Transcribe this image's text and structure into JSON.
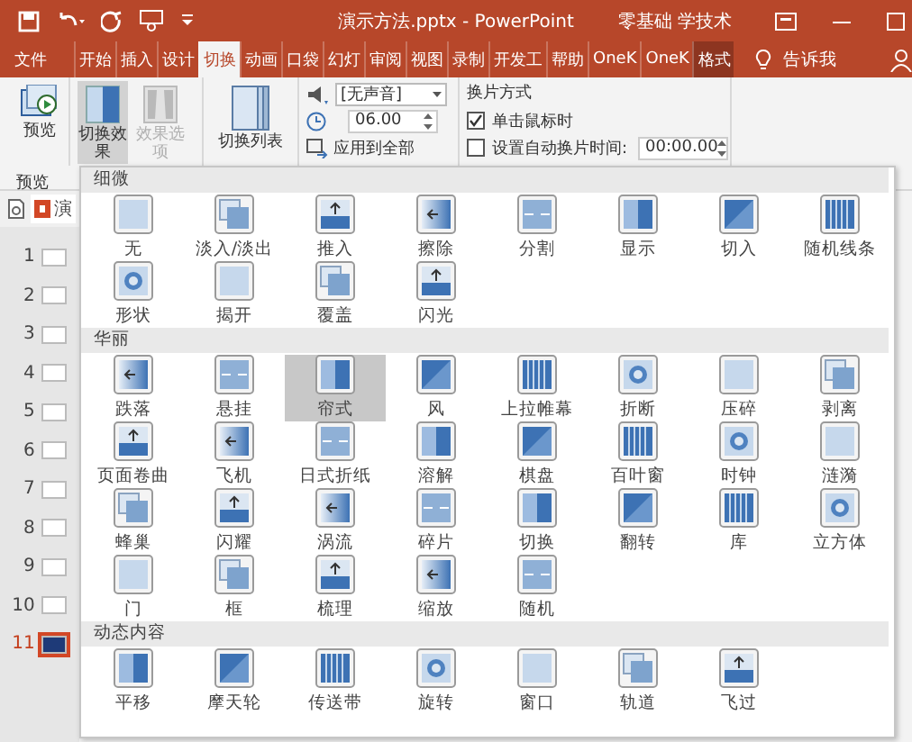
{
  "window": {
    "title": "演示方法.pptx  -  PowerPoint",
    "user": "零基础 学技术"
  },
  "tabs": [
    {
      "label": "文件",
      "selected": false,
      "contextual": false
    },
    {
      "label": "开始",
      "selected": false,
      "contextual": false
    },
    {
      "label": "插入",
      "selected": false,
      "contextual": false
    },
    {
      "label": "设计",
      "selected": false,
      "contextual": false
    },
    {
      "label": "切换",
      "selected": true,
      "contextual": false
    },
    {
      "label": "动画",
      "selected": false,
      "contextual": false
    },
    {
      "label": "口袋",
      "selected": false,
      "contextual": false
    },
    {
      "label": "幻灯",
      "selected": false,
      "contextual": false
    },
    {
      "label": "审阅",
      "selected": false,
      "contextual": false
    },
    {
      "label": "视图",
      "selected": false,
      "contextual": false
    },
    {
      "label": "录制",
      "selected": false,
      "contextual": false
    },
    {
      "label": "开发工",
      "selected": false,
      "contextual": false
    },
    {
      "label": "帮助",
      "selected": false,
      "contextual": false
    },
    {
      "label": "OneK",
      "selected": false,
      "contextual": false
    },
    {
      "label": "OneK",
      "selected": false,
      "contextual": false
    },
    {
      "label": "格式",
      "selected": false,
      "contextual": true
    }
  ],
  "tell_me": "告诉我",
  "ribbon": {
    "preview": "预览",
    "preview_group": "预览",
    "effects": "切换效果",
    "effect_options": {
      "label": "效果选项",
      "disabled": true
    },
    "list": "切换列表",
    "sound": "[无声音]",
    "duration": "06.00",
    "apply_all": "应用到全部",
    "advance_title": "换片方式",
    "on_click": {
      "label": "单击鼠标时",
      "checked": true
    },
    "after": {
      "label": "设置自动换片时间:",
      "checked": false,
      "value": "00:00.00"
    }
  },
  "slides": {
    "tab": "演",
    "items": [
      {
        "number": "1",
        "selected": false
      },
      {
        "number": "2",
        "selected": false
      },
      {
        "number": "3",
        "selected": false
      },
      {
        "number": "4",
        "selected": false
      },
      {
        "number": "5",
        "selected": false
      },
      {
        "number": "6",
        "selected": false
      },
      {
        "number": "7",
        "selected": false
      },
      {
        "number": "8",
        "selected": false
      },
      {
        "number": "9",
        "selected": false
      },
      {
        "number": "10",
        "selected": false
      },
      {
        "number": "11",
        "selected": true
      }
    ]
  },
  "gallery": {
    "sections": [
      {
        "title": "细微",
        "items": [
          {
            "label": "无",
            "selected": false
          },
          {
            "label": "淡入/淡出",
            "selected": false
          },
          {
            "label": "推入",
            "selected": false
          },
          {
            "label": "擦除",
            "selected": false
          },
          {
            "label": "分割",
            "selected": false
          },
          {
            "label": "显示",
            "selected": false
          },
          {
            "label": "切入",
            "selected": false
          },
          {
            "label": "随机线条",
            "selected": false
          },
          {
            "label": "形状",
            "selected": false
          },
          {
            "label": "揭开",
            "selected": false
          },
          {
            "label": "覆盖",
            "selected": false
          },
          {
            "label": "闪光",
            "selected": false
          }
        ]
      },
      {
        "title": "华丽",
        "items": [
          {
            "label": "跌落",
            "selected": false
          },
          {
            "label": "悬挂",
            "selected": false
          },
          {
            "label": "帘式",
            "selected": true
          },
          {
            "label": "风",
            "selected": false
          },
          {
            "label": "上拉帷幕",
            "selected": false
          },
          {
            "label": "折断",
            "selected": false
          },
          {
            "label": "压碎",
            "selected": false
          },
          {
            "label": "剥离",
            "selected": false
          },
          {
            "label": "页面卷曲",
            "selected": false
          },
          {
            "label": "飞机",
            "selected": false
          },
          {
            "label": "日式折纸",
            "selected": false
          },
          {
            "label": "溶解",
            "selected": false
          },
          {
            "label": "棋盘",
            "selected": false
          },
          {
            "label": "百叶窗",
            "selected": false
          },
          {
            "label": "时钟",
            "selected": false
          },
          {
            "label": "涟漪",
            "selected": false
          },
          {
            "label": "蜂巢",
            "selected": false
          },
          {
            "label": "闪耀",
            "selected": false
          },
          {
            "label": "涡流",
            "selected": false
          },
          {
            "label": "碎片",
            "selected": false
          },
          {
            "label": "切换",
            "selected": false
          },
          {
            "label": "翻转",
            "selected": false
          },
          {
            "label": "库",
            "selected": false
          },
          {
            "label": "立方体",
            "selected": false
          },
          {
            "label": "门",
            "selected": false
          },
          {
            "label": "框",
            "selected": false
          },
          {
            "label": "梳理",
            "selected": false
          },
          {
            "label": "缩放",
            "selected": false
          },
          {
            "label": "随机",
            "selected": false
          }
        ]
      },
      {
        "title": "动态内容",
        "items": [
          {
            "label": "平移",
            "selected": false
          },
          {
            "label": "摩天轮",
            "selected": false
          },
          {
            "label": "传送带",
            "selected": false
          },
          {
            "label": "旋转",
            "selected": false
          },
          {
            "label": "窗口",
            "selected": false
          },
          {
            "label": "轨道",
            "selected": false
          },
          {
            "label": "飞过",
            "selected": false
          }
        ]
      }
    ]
  }
}
